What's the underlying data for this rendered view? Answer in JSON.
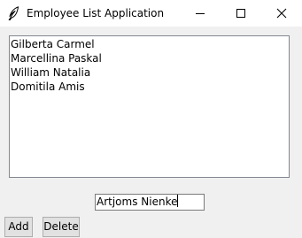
{
  "window": {
    "title": "Employee List Application",
    "icons": {
      "app": "feather-icon",
      "minimize": "minimize-icon",
      "maximize": "maximize-icon",
      "close": "close-icon"
    }
  },
  "employee_list": {
    "items": [
      "Gilberta Carmel",
      "Marcellina Paskal",
      "William Natalia",
      "Domitila Amis"
    ]
  },
  "name_entry": {
    "value": "Artjoms Nienke"
  },
  "buttons": {
    "add_label": "Add",
    "delete_label": "Delete"
  },
  "colors": {
    "window_bg": "#f0f0f0",
    "titlebar_bg": "#ffffff",
    "listbox_border": "#828790",
    "button_bg": "#e1e1e1",
    "button_border": "#adadad"
  }
}
